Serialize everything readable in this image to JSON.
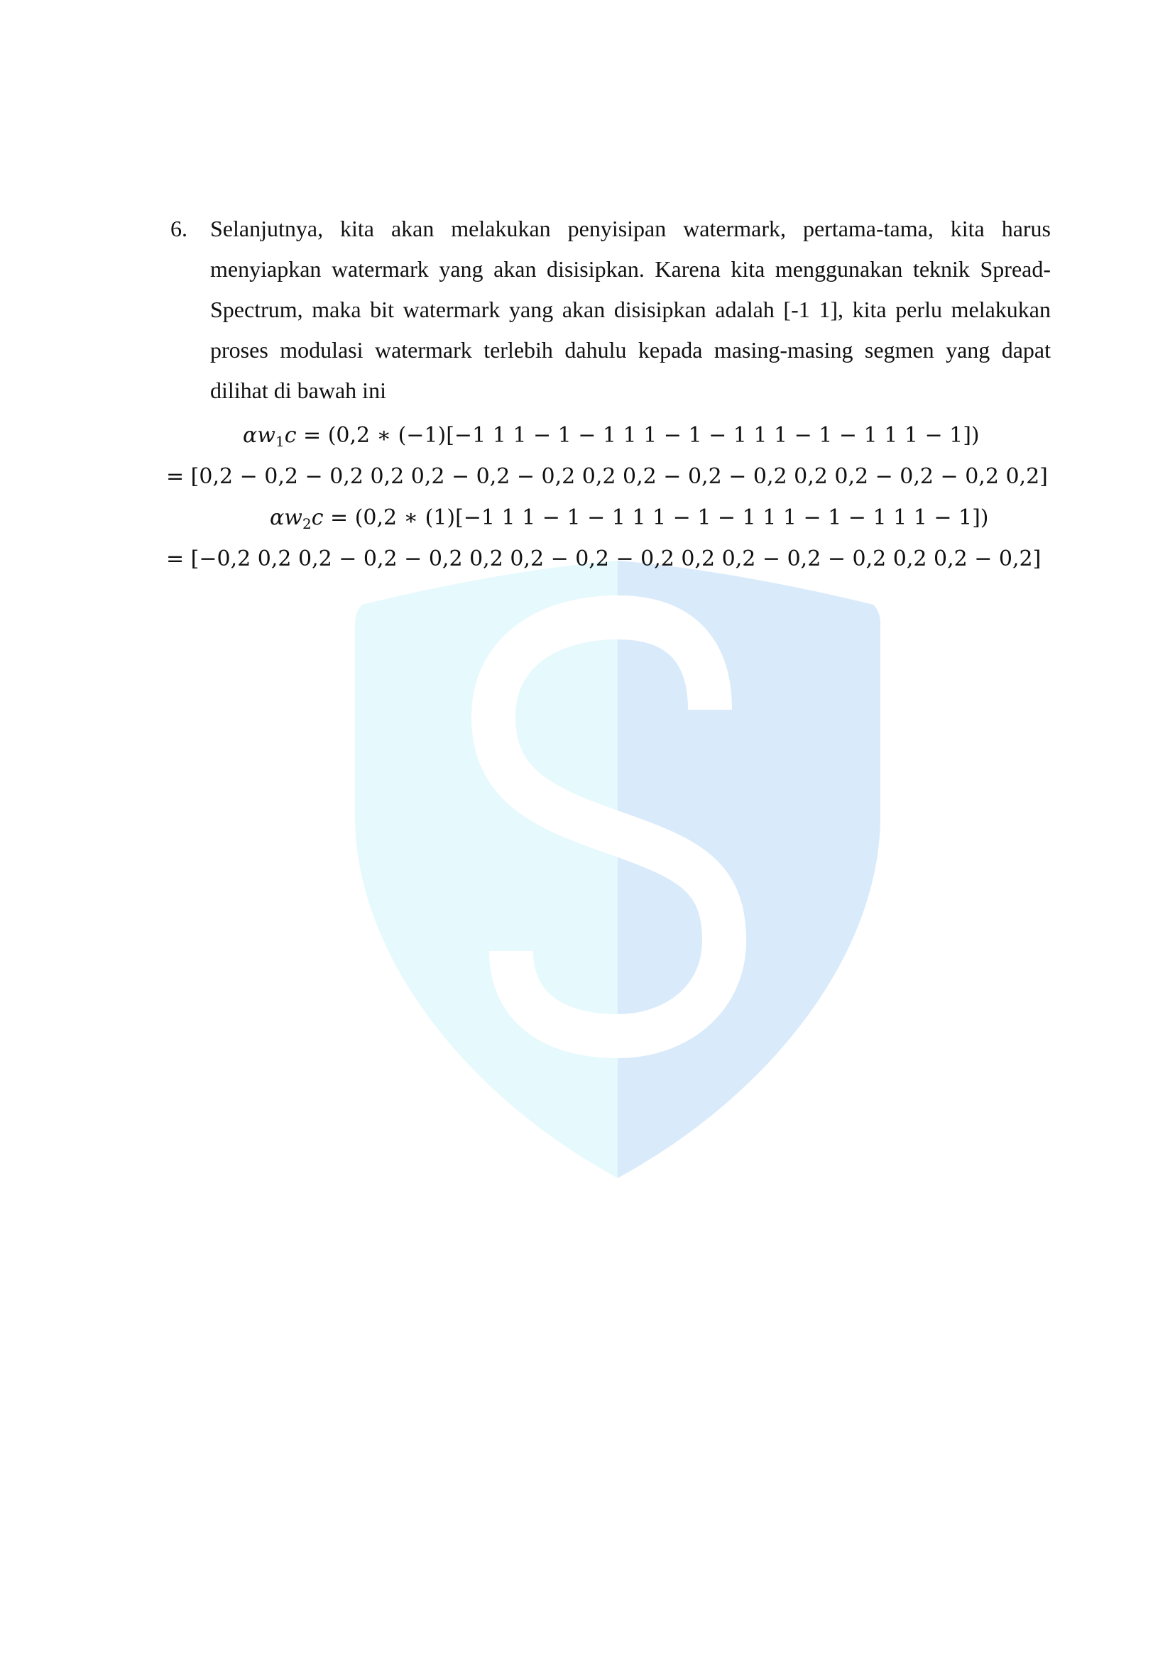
{
  "document": {
    "item_number": "6.",
    "paragraph": "Selanjutnya, kita akan melakukan penyisipan watermark, pertama-tama, kita harus menyiapkan watermark yang akan disisipkan. Karena kita menggunakan teknik Spread-Spectrum, maka bit watermark yang akan disisipkan adalah [-1 1], kita perlu melakukan proses modulasi watermark terlebih dahulu kepada masing-masing segmen yang dapat dilihat di bawah ini",
    "equations": [
      {
        "alpha": "α",
        "var": "w",
        "subscript": "1",
        "var2": "c",
        "rhs": "= (0,2 ∗ (−1)[−1 1 1 − 1 − 1 1 1 − 1 − 1 1 1 − 1 − 1 1 1 − 1])"
      },
      {
        "result": "=  [0,2  − 0,2  − 0,2 0,2 0,2  − 0,2  − 0,2 0,2 0,2  − 0,2  − 0,2 0,2 0,2  − 0,2  − 0,2 0,2]"
      },
      {
        "alpha": "α",
        "var": "w",
        "subscript": "2",
        "var2": "c",
        "rhs": "= (0,2 ∗ (1)[−1 1 1 − 1 − 1 1 1 − 1 − 1 1 1 − 1 − 1 1 1 − 1])"
      },
      {
        "result": "=  [−0,2 0,2 0,2  − 0,2  − 0,2 0,2 0,2  − 0,2  − 0,2 0,2 0,2  − 0,2  − 0,2 0,2 0,2  − 0,2]"
      }
    ]
  },
  "watermark": {
    "icon": "shield-s-logo-icon",
    "colors": {
      "left": "#e6f9fc",
      "right": "#d9ebfb",
      "letter": "#ffffff"
    }
  }
}
